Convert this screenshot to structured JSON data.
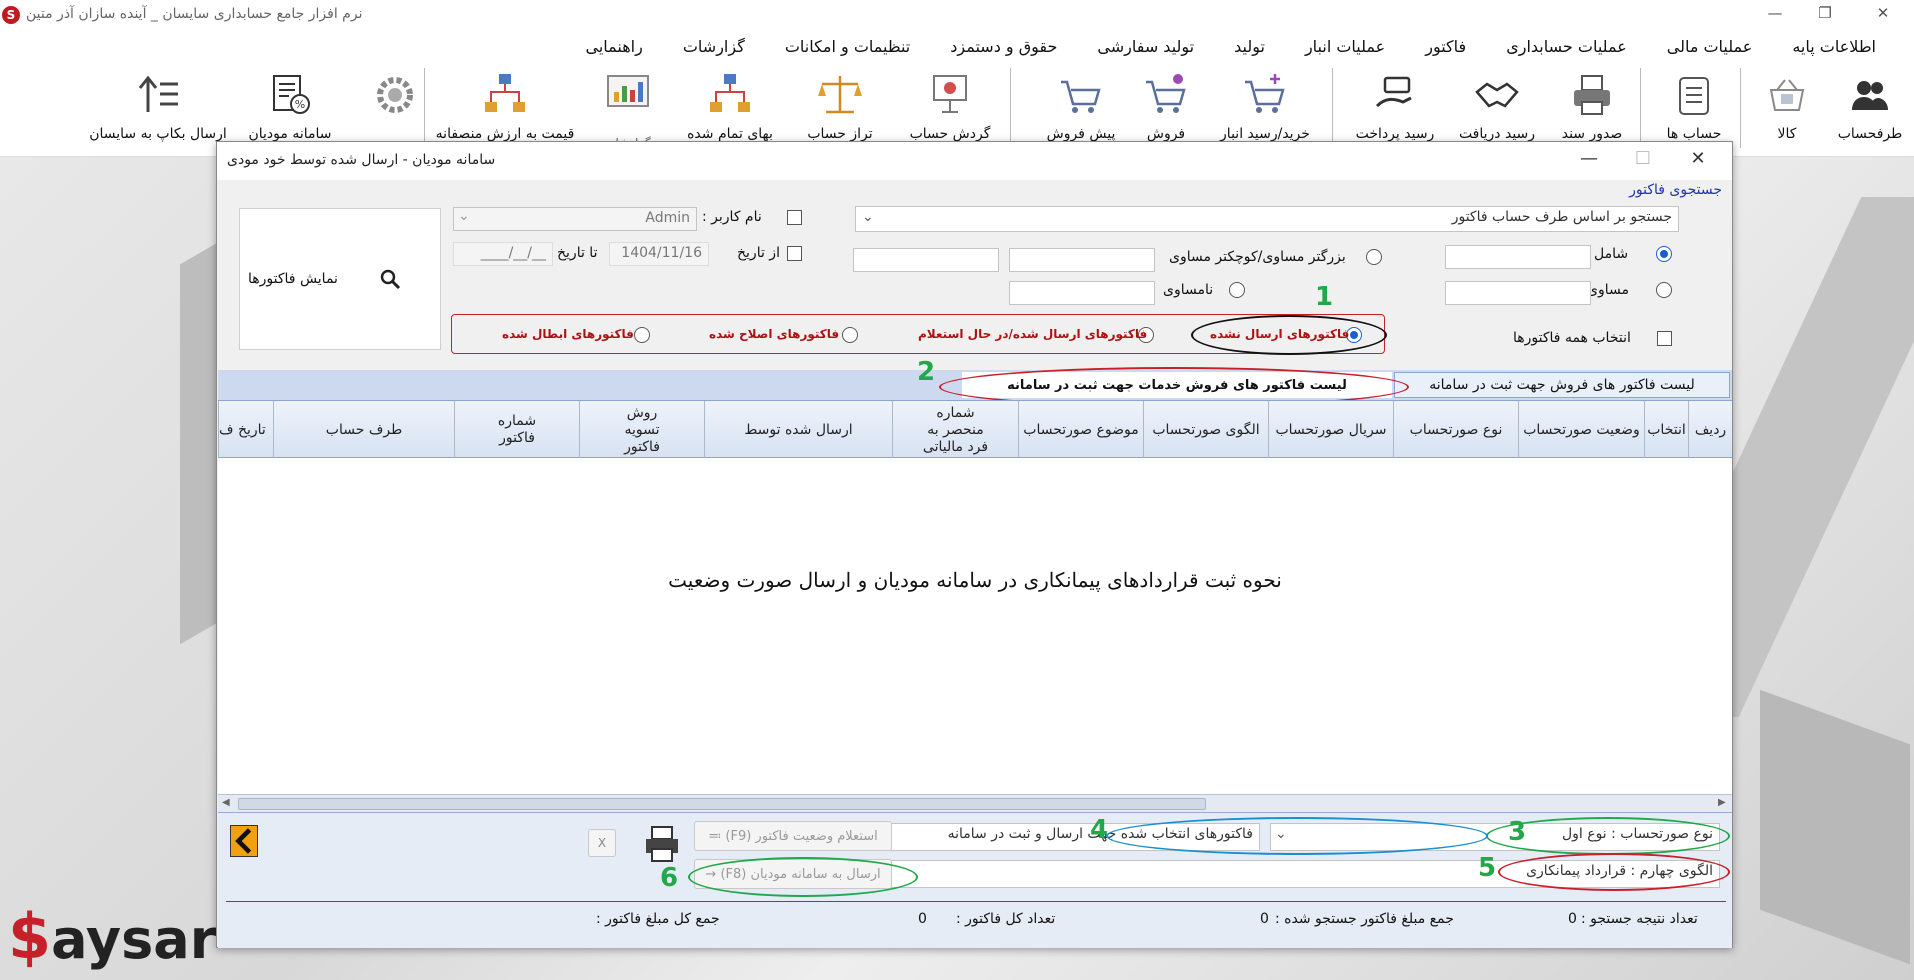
{
  "app": {
    "title": "نرم افزار جامع حسابداری سایسان _ آینده سازان آذر متین",
    "logo": "S"
  },
  "menu": [
    "اطلاعات پایه",
    "عملیات مالی",
    "عملیات حسابداری",
    "فاکتور",
    "عملیات انبار",
    "تولید",
    "تولید سفارشی",
    "حقوق و دستمزد",
    "تنظیمات و امکانات",
    "گزارشات",
    "راهنمایی"
  ],
  "toolbar": [
    {
      "label": "طرفحساب",
      "icon": "people-icon"
    },
    {
      "label": "کالا",
      "icon": "basket-icon"
    },
    {
      "label": "حساب ها",
      "icon": "ledger-icon"
    },
    {
      "label": "صدور سند",
      "icon": "printer-icon"
    },
    {
      "label": "رسید دریافت",
      "icon": "handshake-icon"
    },
    {
      "label": "رسید پرداخت",
      "icon": "hand-money-icon"
    },
    {
      "label": "خرید/رسید انبار",
      "icon": "cart-add-icon"
    },
    {
      "label": "فروش",
      "icon": "cart-remove-icon"
    },
    {
      "label": "پیش  فروش",
      "icon": "cart-icon"
    },
    {
      "label": "گردش حساب",
      "icon": "presentation-icon"
    },
    {
      "label": "تراز حساب",
      "icon": "scale-icon"
    },
    {
      "label": "بهای تمام شده",
      "icon": "network-icon"
    },
    {
      "label": "گزارشات",
      "icon": "report-chart-icon"
    },
    {
      "label": "قیمت به ارزش منصفانه",
      "icon": "network-icon"
    },
    {
      "label": "",
      "icon": "settings-gear-icon"
    },
    {
      "label": "سامانه مودیان",
      "icon": "tax-doc-icon"
    },
    {
      "label": "ارسال بکاپ به سایسان",
      "icon": "upload-icon"
    }
  ],
  "dialog": {
    "title": "سامانه مودیان    -    ارسال شده توسط خود مودی",
    "search_link": "جستجوی فاکتور",
    "search_combo": "جستجو بر اساس طرف حساب فاکتور",
    "radio_includes": "شامل",
    "radio_equal": "مساوی",
    "radio_ge_le": "بزرگتر مساوی/کوچکتر مساوی",
    "radio_not_equal": "نامساوی",
    "username_label": "نام کاربر :",
    "username_value": "Admin",
    "from_date_label": "از تاریخ",
    "from_date_value": "1404/11/16",
    "to_date_label": "تا تاریخ",
    "to_date_value": "__/__/____",
    "show_invoices": "نمایش فاکتورها",
    "select_all": "انتخاب همه فاکتورها",
    "status_options": [
      "فاکتورهای ارسال نشده",
      "فاکتورهای ارسال شده/در حال استعلام",
      "فاکتورهای اصلاح شده",
      "فاکتورهای ابطال شده"
    ],
    "tab_1": "لیست فاکتور های فروش جهت ثبت در سامانه",
    "tab_2": "لیست فاکتور های فروش خدمات جهت ثبت در سامانه",
    "columns": [
      "ردیف",
      "انتخاب",
      "وضعیت صورتحساب",
      "نوع صورتحساب",
      "سریال صورتحساب",
      "الگوی صورتحساب",
      "موضوع صورتحساب",
      "شماره منحصر به فرد مالیاتی",
      "ارسال شده توسط",
      "روش تسویه فاکتور",
      "شماره فاکتور",
      "طرف حساب",
      "تاریخ ف"
    ],
    "overlay_caption": "نحوه ثبت قراردادهای پیمانکاری در سامانه مودیان و ارسال صورت وضعیت",
    "invoice_type": "نوع صورتحساب : نوع اول",
    "invoice_pattern": "الگوی چهارم : قرارداد پیمانکاری",
    "selected_action": "فاکتورهای انتخاب شده جهت ارسال و ثبت در سامانه",
    "btn_inquiry": "استعلام وضعیت فاکتور (F9)",
    "btn_send": "ارسال به سامانه مودیان (F8)",
    "footer": {
      "search_count_label": "تعداد نتیجه جستجو :",
      "search_count": "0",
      "search_sum_label": "جمع مبلغ فاکتور جستجو شده :",
      "search_sum": "0",
      "total_count_label": "تعداد کل فاکتور :",
      "total_count": "0",
      "total_sum_label": "جمع کل مبلغ فاکتور :"
    }
  },
  "annotations": [
    "1",
    "2",
    "3",
    "4",
    "5",
    "6"
  ],
  "watermark": "aysar",
  "colors": {
    "accent_red": "#c8202a",
    "accent_green": "#20a84a",
    "accent_blue": "#1a8fd0"
  }
}
